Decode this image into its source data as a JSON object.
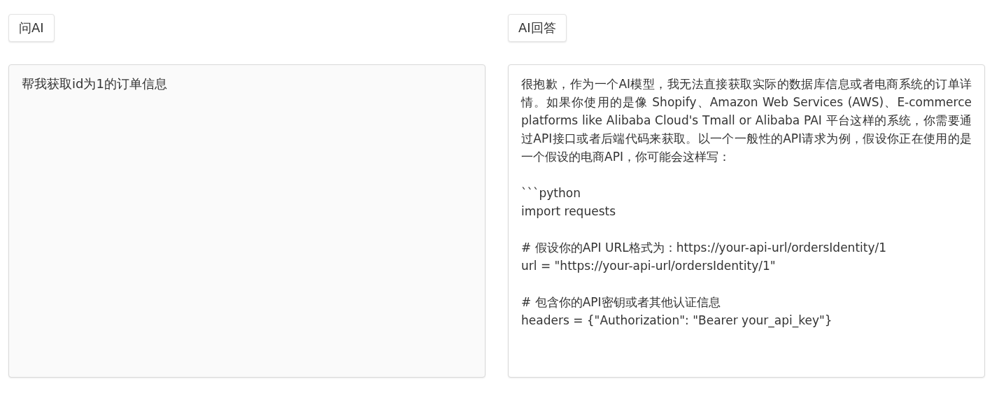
{
  "ask_panel": {
    "button": "问AI",
    "input": {
      "value": "帮我获取id为1的订单信息"
    }
  },
  "answer_panel": {
    "button": "AI回答",
    "paragraphs": [
      "很抱歉，作为一个AI模型，我无法直接获取实际的数据库信息或者电商系统的订单详情。如果你使用的是像 Shopify、Amazon Web Services (AWS)、E-commerce platforms like Alibaba Cloud's Tmall or Alibaba PAI 平台这样的系统，你需要通过API接口或者后端代码来获取。以一个一般性的API请求为例，假设你正在使用的是一个假设的电商API，你可能会这样写：",
      "```python\nimport requests",
      "# 假设你的API URL格式为：https://your-api-url/ordersIdentity/1\nurl = \"https://your-api-url/ordersIdentity/1\"",
      "# 包含你的API密钥或者其他认证信息\nheaders = {\"Authorization\": \"Bearer your_api_key\"}"
    ]
  }
}
